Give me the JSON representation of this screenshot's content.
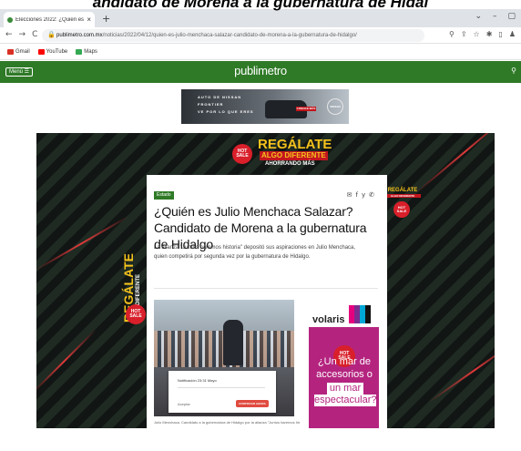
{
  "caption_banner": "andidato de Morena a la gubernatura de Hidal",
  "browser": {
    "tab_title": "Elecciones 2022: ¿Quién es Julio",
    "tab_close": "×",
    "new_tab": "+",
    "window_controls": [
      "⌄",
      "–",
      "▢"
    ],
    "nav": {
      "back": "←",
      "forward": "→",
      "reload": "C"
    },
    "url_host": "publimetro.com.mx",
    "url_path": "/noticias/2022/04/12/quien-es-julio-menchaca-salazar-candidato-de-morena-a-la-gubernatura-de-hidalgo/",
    "omnibox_icons": [
      "⚲",
      "⇪",
      "☆",
      "✱",
      "▯",
      "♟"
    ],
    "bookmarks": [
      {
        "label": "Gmail",
        "color": "#d93025",
        "icon": "gmail-icon"
      },
      {
        "label": "YouTube",
        "color": "#ff0000",
        "icon": "youtube-icon"
      },
      {
        "label": "Maps",
        "color": "#34a853",
        "icon": "maps-icon"
      }
    ]
  },
  "site": {
    "menu_label": "Menú ☰",
    "logo": "publimetro",
    "search_icon": "⚲",
    "brand_green": "#2f7a27"
  },
  "top_ad": {
    "line1": "AUTO DE NISSAN",
    "line2": "FRONTIER",
    "line3": "VE POR LO QUE ERES",
    "cta": "CONOCE MÁS",
    "brand": "NISSAN"
  },
  "promo": {
    "headline": "REGÁLATE",
    "sub": "ALGO DIFERENTE",
    "tagline": "AHORRANDO MÁS",
    "badge_line1": "HOT",
    "badge_line2": "SALE"
  },
  "article": {
    "section_tag": "Estado",
    "share_icons": [
      "✉",
      "f",
      "y",
      "✆"
    ],
    "headline": "¿Quién es Julio Menchaca Salazar? Candidato de Morena a la gubernatura de Hidalgo",
    "lede": "La alianza \"Juntos haremos historia\" depositó sus aspiraciones en Julio Menchaca, quien competirá por segunda vez por la gubernatura de Hidalgo.",
    "photo_caption": "Julio Menchaca. Candidato a la gubernatura de Hidalgo por la alianza \"Juntos haremos historia\"",
    "popup_text": "Notificación 23:31 Mayo",
    "popup_label": "Aceptar",
    "popup_button": "CONTINUAR AHORA"
  },
  "side_ad": {
    "brand": "volaris",
    "line1": "¿Un mar de",
    "line2": "accesorios o",
    "highlight1": "un mar",
    "highlight2": "espectacular?",
    "bg_color": "#b4247f"
  }
}
